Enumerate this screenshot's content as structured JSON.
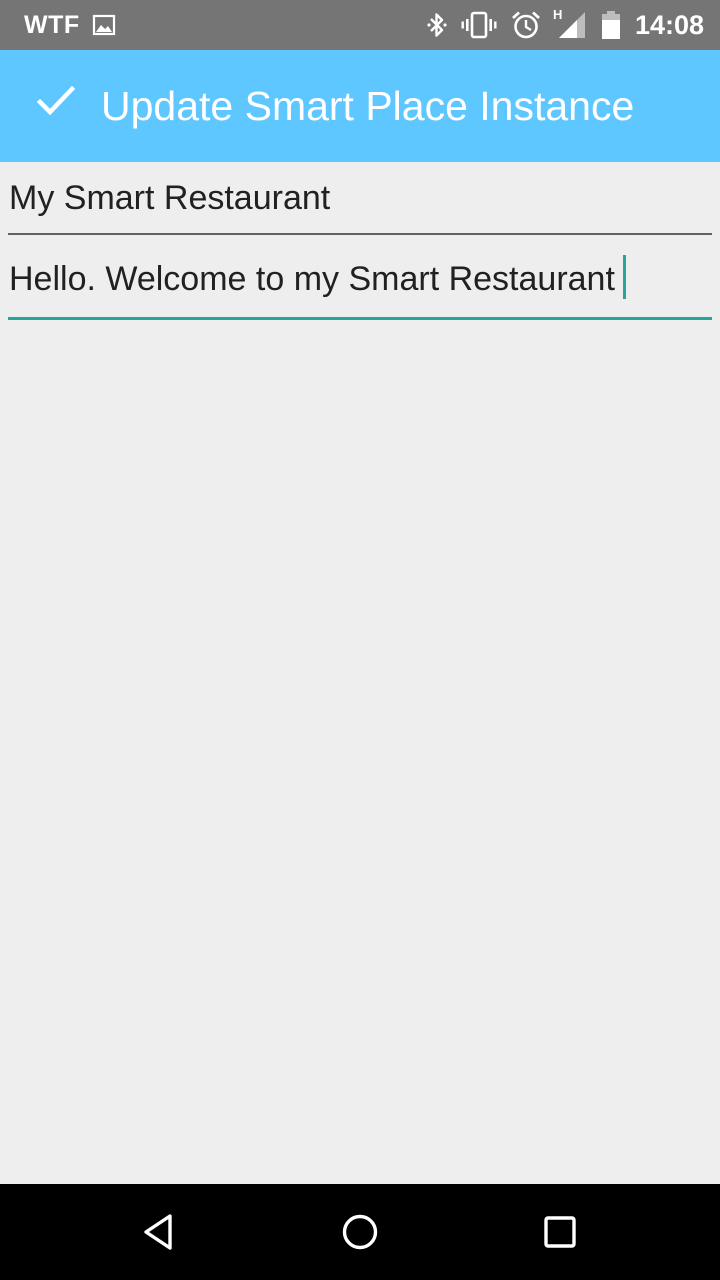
{
  "status_bar": {
    "carrier": "WTF",
    "time": "14:08",
    "network_type": "H",
    "icons": [
      "image-icon",
      "bluetooth-icon",
      "vibrate-icon",
      "alarm-icon",
      "signal-icon",
      "battery-icon"
    ]
  },
  "app_bar": {
    "title": "Update Smart Place Instance",
    "action_icon": "check-icon",
    "background_color": "#5fc7ff"
  },
  "form": {
    "name_field": {
      "value": "My Smart Restaurant"
    },
    "description_field": {
      "value": "Hello. Welcome to my Smart Restaurant",
      "focused": true,
      "accent_color": "#26a69a"
    }
  },
  "nav_bar": {
    "buttons": [
      "back-icon",
      "home-icon",
      "recents-icon"
    ]
  }
}
